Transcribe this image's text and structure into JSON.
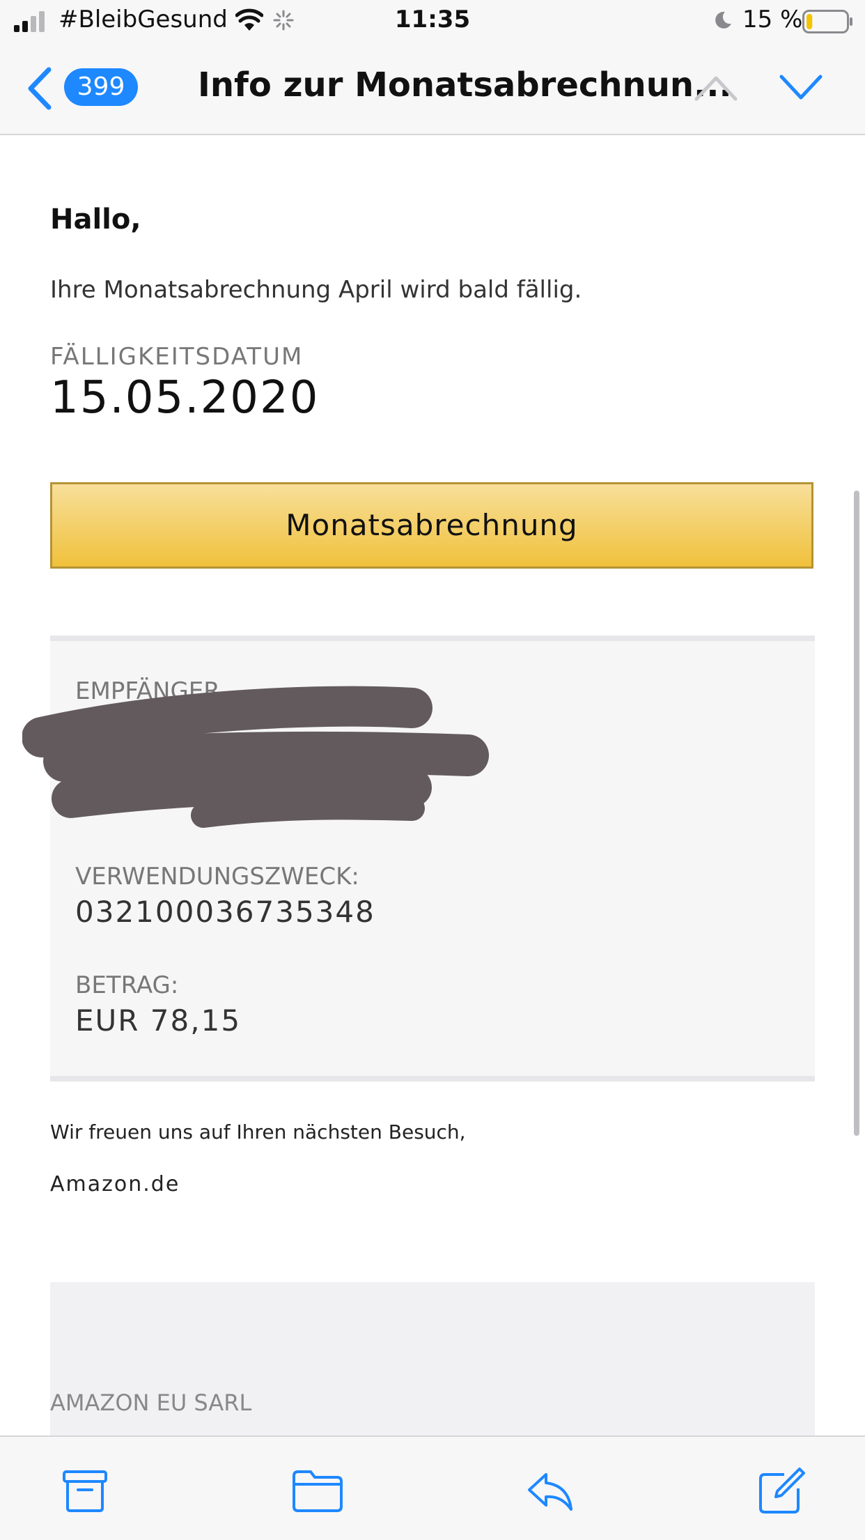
{
  "status_bar": {
    "carrier": "#BleibGesund",
    "time": "11:35",
    "battery_percent": "15 %",
    "battery_level": 0.15,
    "icons": [
      "signal-icon",
      "wifi-icon",
      "activity-spinner-icon",
      "moon-icon",
      "battery-icon"
    ]
  },
  "nav": {
    "back_icon": "chevron-left-icon",
    "unread_count": "399",
    "title": "Info zur Monatsabrechnun...",
    "prev_icon": "chevron-up-icon",
    "next_icon": "chevron-down-icon"
  },
  "email": {
    "greeting": "Hallo,",
    "intro": "Ihre Monatsabrechnung April wird bald fällig.",
    "due_label": "FÄLLIGKEITSDATUM",
    "due_date": "15.05.2020",
    "button_label": "Monatsabrechnung",
    "recipient_label": "EMPFÄNGER",
    "purpose_label": "VERWENDUNGSZWECK:",
    "purpose_value": "032100036735348",
    "amount_label": "BETRAG:",
    "amount_value": "EUR 78,15",
    "closing": "Wir freuen uns auf Ihren nächsten Besuch,",
    "signature": "Amazon.de",
    "footer_company": "AMAZON EU SARL"
  },
  "toolbar": {
    "items": [
      "archive-icon",
      "folder-icon",
      "reply-icon",
      "compose-icon"
    ]
  },
  "colors": {
    "accent": "#1e88ff",
    "button_top": "#f8df9a",
    "button_bottom": "#f0c13c",
    "redaction": "#635a5e"
  }
}
